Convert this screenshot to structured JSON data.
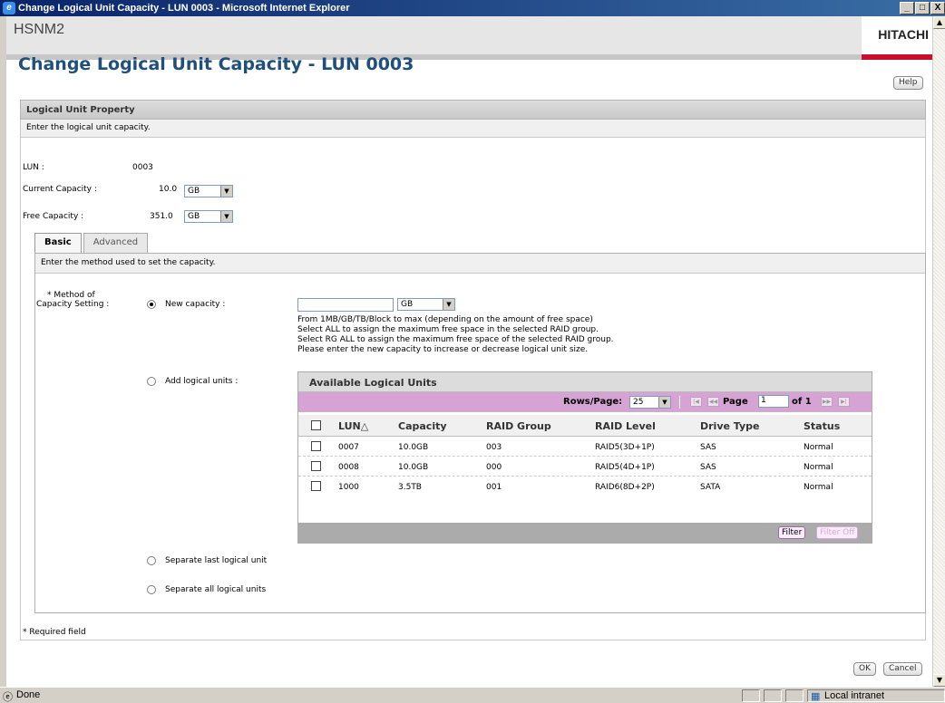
{
  "window": {
    "title": "Change Logical Unit Capacity - LUN 0003 - Microsoft Internet Explorer",
    "min": "_",
    "max": "□",
    "close": "X"
  },
  "app": {
    "name": "HSNM2",
    "brand": "HITACHI"
  },
  "page": {
    "title": "Change Logical Unit Capacity - LUN 0003",
    "help": "Help"
  },
  "property": {
    "header": "Logical Unit Property",
    "description": "Enter the logical unit capacity.",
    "lun_label": "LUN :",
    "lun_value": "0003",
    "current_label": "Current Capacity :",
    "current_value": "10.0",
    "current_unit": "GB",
    "free_label": "Free Capacity :",
    "free_value": "351.0",
    "free_unit": "GB"
  },
  "tabs": [
    {
      "label": "Basic",
      "active": true
    },
    {
      "label": "Advanced",
      "active": false
    }
  ],
  "basic": {
    "description": "Enter the method used to set the capacity.",
    "method_label_1": "* Method of",
    "method_label_2": "Capacity Setting :",
    "new_capacity": {
      "label": "New capacity :",
      "selected": true,
      "value": "",
      "unit": "GB"
    },
    "help_lines": [
      "From 1MB/GB/TB/Block to max (depending on the amount of free space)",
      "Select ALL to assign the maximum free space in the selected RAID group.",
      "Select RG ALL to assign the maximum free space of the selected RAID group.",
      "Please enter the new capacity to increase or decrease logical unit size."
    ],
    "add_units": {
      "label": "Add logical units :",
      "selected": false
    },
    "separate_last": {
      "label": "Separate last logical unit",
      "selected": false
    },
    "separate_all": {
      "label": "Separate all logical units",
      "selected": false
    }
  },
  "table": {
    "title": "Available Logical Units",
    "rows_per_page_label": "Rows/Page:",
    "rows_per_page": "25",
    "page_label": "Page",
    "page_value": "1",
    "of_label": "of 1",
    "columns": [
      "LUN",
      "Capacity",
      "RAID Group",
      "RAID Level",
      "Drive Type",
      "Status"
    ],
    "sort_indicator": "△",
    "rows": [
      {
        "lun": "0007",
        "capacity": "10.0GB",
        "raid_group": "003",
        "raid_level": "RAID5(3D+1P)",
        "drive_type": "SAS",
        "status": "Normal"
      },
      {
        "lun": "0008",
        "capacity": "10.0GB",
        "raid_group": "000",
        "raid_level": "RAID5(4D+1P)",
        "drive_type": "SAS",
        "status": "Normal"
      },
      {
        "lun": "1000",
        "capacity": "3.5TB",
        "raid_group": "001",
        "raid_level": "RAID6(8D+2P)",
        "drive_type": "SATA",
        "status": "Normal"
      }
    ],
    "filter": "Filter",
    "filter_off": "Filter Off"
  },
  "footer": {
    "required": "* Required field",
    "ok": "OK",
    "cancel": "Cancel"
  },
  "statusbar": {
    "status": "Done",
    "zone": "Local intranet"
  }
}
